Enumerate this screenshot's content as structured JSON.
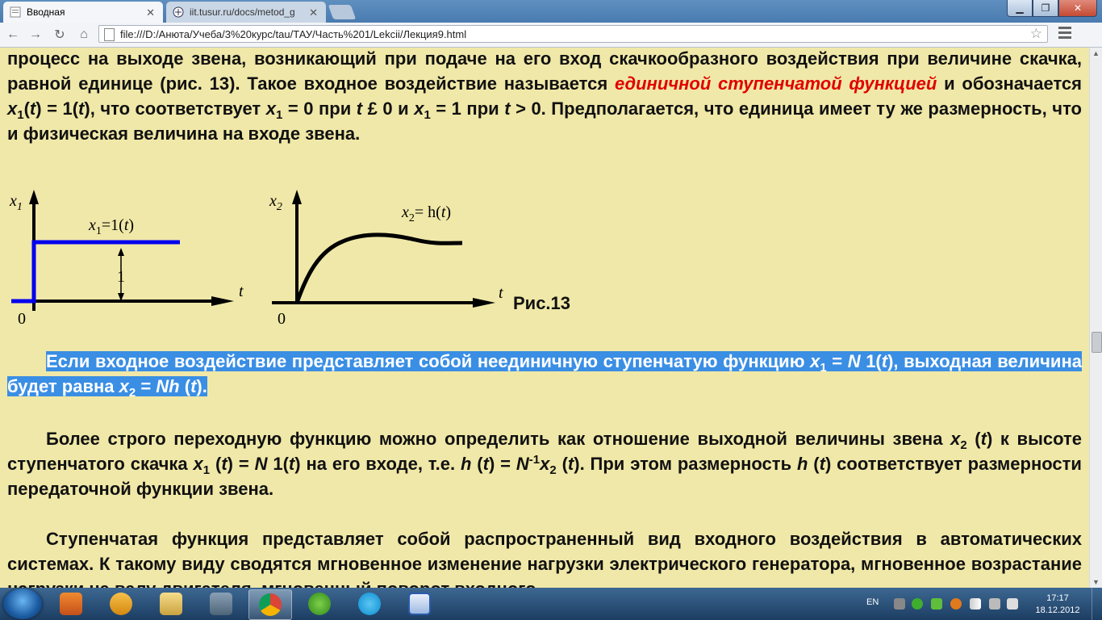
{
  "browser": {
    "tabs": [
      {
        "label": "Вводная"
      },
      {
        "label": "iit.tusur.ru/docs/metod_g"
      }
    ],
    "address": "file:///D:/Анюта/Учеба/3%20курс/tau/ТАУ/Часть%201/Lekcii/Лекция9.html"
  },
  "article": {
    "p1": {
      "a": "процесс на выходе звена, возникающий при подаче на его вход скачкообразного воздействия при величине скачка, равной единице (рис. 13). Такое входное воздействие называется ",
      "term": "единичной ступенчатой функцией",
      "b": " и обозначается ",
      "c": " = 1(",
      "d": "), что соответствует ",
      "e": " = 0 при ",
      "f": " £ 0 и ",
      "g": " = 1 при ",
      "h": " > 0. Предполагается, что единица имеет ту же размерность, что и физическая величина на входе звена."
    },
    "figure": {
      "caption": "Рис.13",
      "g1": {
        "ylabel": "x",
        "ysub": "1",
        "formula_a": "x",
        "formula_sub": "1",
        "formula_b": "=1(",
        "formula_c": "t",
        "formula_d": ")",
        "one": "1",
        "zero": "0",
        "xlabel": "t"
      },
      "g2": {
        "ylabel": "x",
        "ysub": "2",
        "formula_a": "x",
        "formula_sub": "2",
        "formula_b": "= h(",
        "formula_c": "t",
        "formula_d": ")",
        "zero": "0",
        "xlabel": "t"
      }
    },
    "p2": {
      "a": "Если входное воздействие представляет собой неединичную ступенчатую функцию ",
      "b": " = ",
      "c": " 1(",
      "d": "), выходная величина будет равна ",
      "e": " = ",
      "f": " (",
      "g": ")."
    },
    "p3": {
      "a": "Более строго переходную функцию можно определить как отношение выходной величины звена ",
      "b": " (",
      "c": ") к высоте ступенчатого скачка ",
      "d": " (",
      "e": ") = ",
      "f": " 1(",
      "g": ") на его входе, т.е. ",
      "h": " (",
      "i": ") = ",
      "j": " (",
      "k": "). При этом размерность ",
      "l": " (",
      "m": ") соответствует размерности передаточной функции звена."
    },
    "p4": {
      "a": "Ступенчатая функция представляет собой распространенный вид входного воздействия в автоматических системах. К такому виду сводятся мгновенное изменение нагрузки электрического генератора, мгновенное возрастание нагрузки на валу двигателя, мгновенный поворот входного"
    },
    "sym": {
      "x": "x",
      "t": "t",
      "one": "1",
      "two": "2",
      "N": "N",
      "h": "h",
      "Nh": "Nh",
      "neg1": "-1"
    }
  },
  "taskbar": {
    "lang": "EN",
    "time": "17:17",
    "date": "18.12.2012"
  },
  "colors": {
    "page_bg": "#f0e8a8",
    "highlight": "#3a8ee4",
    "term_red": "#e10000",
    "step_blue": "#0000ee"
  },
  "icons": [
    "chrome-tab-icon",
    "site-tab-icon",
    "back-icon",
    "forward-icon",
    "reload-icon",
    "home-icon",
    "star-icon",
    "menu-icon",
    "start-orb-icon",
    "media-player-icon",
    "vlc-icon",
    "explorer-icon",
    "m-app-icon",
    "chrome-icon",
    "utorrent-icon",
    "skype-icon",
    "word-icon"
  ]
}
